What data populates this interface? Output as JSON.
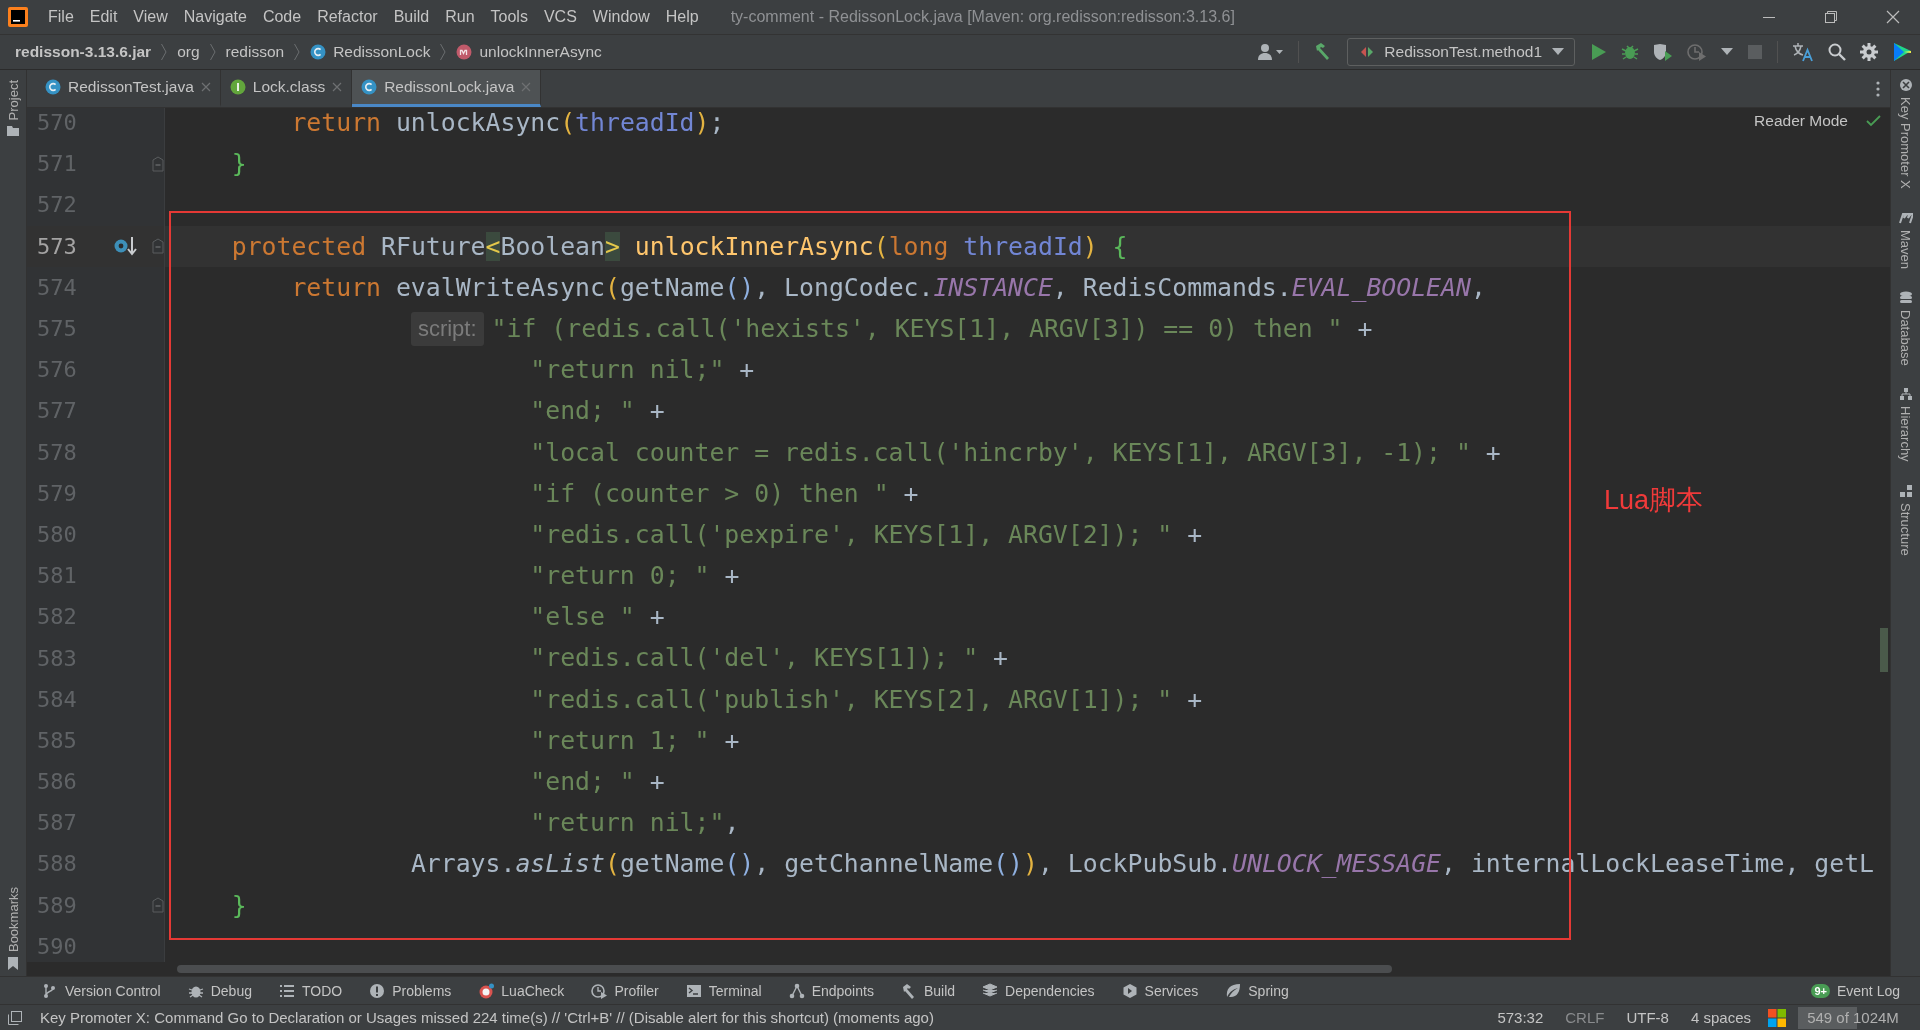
{
  "menu_bar": {
    "items": [
      {
        "label": "File"
      },
      {
        "label": "Edit"
      },
      {
        "label": "View"
      },
      {
        "label": "Navigate"
      },
      {
        "label": "Code"
      },
      {
        "label": "Refactor"
      },
      {
        "label": "Build"
      },
      {
        "label": "Run"
      },
      {
        "label": "Tools"
      },
      {
        "label": "VCS"
      },
      {
        "label": "Window"
      },
      {
        "label": "Help"
      }
    ],
    "title": "ty-comment - RedissonLock.java [Maven: org.redisson:redisson:3.13.6]"
  },
  "breadcrumbs": [
    {
      "label": "redisson-3.13.6.jar",
      "kind": "jar"
    },
    {
      "label": "org",
      "kind": "package"
    },
    {
      "label": "redisson",
      "kind": "package"
    },
    {
      "label": "RedissonLock",
      "kind": "class"
    },
    {
      "label": "unlockInnerAsync",
      "kind": "method"
    }
  ],
  "run_configuration": "RedissonTest.method1",
  "tabs": [
    {
      "label": "RedissonTest.java",
      "kind": "class",
      "selected": false
    },
    {
      "label": "Lock.class",
      "kind": "interface",
      "selected": false
    },
    {
      "label": "RedissonLock.java",
      "kind": "class",
      "selected": true
    }
  ],
  "left_tool_strip": [
    "Project",
    "Bookmarks"
  ],
  "right_tool_strip": [
    {
      "label": "Key Promoter X",
      "kind": "keypromoter"
    },
    {
      "label": "Maven",
      "kind": "maven"
    },
    {
      "label": "Database",
      "kind": "database"
    },
    {
      "label": "Hierarchy",
      "kind": "hierarchy"
    },
    {
      "label": "Structure",
      "kind": "structure"
    }
  ],
  "editor": {
    "reader_mode": "Reader Mode",
    "annotation": "Lua脚本",
    "lines": [
      {
        "number": "570",
        "current": false,
        "fold": false,
        "tokens": [
          {
            "kind": "keyword",
            "text": "        return"
          },
          {
            "kind": "plain",
            "text": " unlockAsync"
          },
          {
            "kind": "paren",
            "text": "("
          },
          {
            "kind": "param",
            "text": "threadId"
          },
          {
            "kind": "paren",
            "text": ")"
          },
          {
            "kind": "plain",
            "text": ";"
          }
        ]
      },
      {
        "number": "571",
        "current": false,
        "fold": true,
        "tokens": [
          {
            "kind": "brace",
            "text": "    }"
          }
        ]
      },
      {
        "number": "572",
        "current": false,
        "fold": false
      },
      {
        "number": "573",
        "current": true,
        "fold": true,
        "override_marker": true,
        "tokens": [
          {
            "kind": "keyword",
            "text": "    protected"
          },
          {
            "kind": "plain",
            "text": " RFuture"
          },
          {
            "kind": "angle",
            "text": "<"
          },
          {
            "kind": "plain",
            "text": "Boolean"
          },
          {
            "kind": "angle",
            "text": ">"
          },
          {
            "kind": "declaration",
            "text": " unlockInnerAsync"
          },
          {
            "kind": "paren",
            "text": "("
          },
          {
            "kind": "keyword",
            "text": "long"
          },
          {
            "kind": "param",
            "text": " threadId"
          },
          {
            "kind": "paren",
            "text": ")"
          },
          {
            "kind": "brace",
            "text": " {"
          }
        ]
      },
      {
        "number": "574",
        "current": false,
        "fold": false,
        "tokens": [
          {
            "kind": "keyword",
            "text": "        return"
          },
          {
            "kind": "plain",
            "text": " evalWriteAsync"
          },
          {
            "kind": "paren",
            "text": "("
          },
          {
            "kind": "plain",
            "text": "getName"
          },
          {
            "kind": "paren2",
            "text": "()"
          },
          {
            "kind": "plain",
            "text": ", LongCodec."
          },
          {
            "kind": "field",
            "text": "INSTANCE"
          },
          {
            "kind": "plain",
            "text": ", RedisCommands."
          },
          {
            "kind": "field",
            "text": "EVAL_BOOLEAN"
          },
          {
            "kind": "plain",
            "text": ","
          }
        ]
      },
      {
        "number": "575",
        "current": false,
        "fold": false,
        "tokens": [
          {
            "kind": "hint",
            "text": "                script:"
          },
          {
            "kind": "string",
            "text": "\"if (redis.call('hexists', KEYS[1], ARGV[3]) == 0) then \""
          },
          {
            "kind": "plain",
            "text": " +"
          }
        ]
      },
      {
        "number": "576",
        "current": false,
        "fold": false,
        "tokens": [
          {
            "kind": "string",
            "text": "                        \"return nil;\""
          },
          {
            "kind": "plain",
            "text": " +"
          }
        ]
      },
      {
        "number": "577",
        "current": false,
        "fold": false,
        "tokens": [
          {
            "kind": "string",
            "text": "                        \"end; \""
          },
          {
            "kind": "plain",
            "text": " +"
          }
        ]
      },
      {
        "number": "578",
        "current": false,
        "fold": false,
        "tokens": [
          {
            "kind": "string",
            "text": "                        \"local counter = redis.call('hincrby', KEYS[1], ARGV[3], -1); \""
          },
          {
            "kind": "plain",
            "text": " +"
          }
        ]
      },
      {
        "number": "579",
        "current": false,
        "fold": false,
        "tokens": [
          {
            "kind": "string",
            "text": "                        \"if (counter > 0) then \""
          },
          {
            "kind": "plain",
            "text": " +"
          }
        ]
      },
      {
        "number": "580",
        "current": false,
        "fold": false,
        "tokens": [
          {
            "kind": "string",
            "text": "                        \"redis.call('pexpire', KEYS[1], ARGV[2]); \""
          },
          {
            "kind": "plain",
            "text": " +"
          }
        ]
      },
      {
        "number": "581",
        "current": false,
        "fold": false,
        "tokens": [
          {
            "kind": "string",
            "text": "                        \"return 0; \""
          },
          {
            "kind": "plain",
            "text": " +"
          }
        ]
      },
      {
        "number": "582",
        "current": false,
        "fold": false,
        "tokens": [
          {
            "kind": "string",
            "text": "                        \"else \""
          },
          {
            "kind": "plain",
            "text": " +"
          }
        ]
      },
      {
        "number": "583",
        "current": false,
        "fold": false,
        "tokens": [
          {
            "kind": "string",
            "text": "                        \"redis.call('del', KEYS[1]); \""
          },
          {
            "kind": "plain",
            "text": " +"
          }
        ]
      },
      {
        "number": "584",
        "current": false,
        "fold": false,
        "tokens": [
          {
            "kind": "string",
            "text": "                        \"redis.call('publish', KEYS[2], ARGV[1]); \""
          },
          {
            "kind": "plain",
            "text": " +"
          }
        ]
      },
      {
        "number": "585",
        "current": false,
        "fold": false,
        "tokens": [
          {
            "kind": "string",
            "text": "                        \"return 1; \""
          },
          {
            "kind": "plain",
            "text": " +"
          }
        ]
      },
      {
        "number": "586",
        "current": false,
        "fold": false,
        "tokens": [
          {
            "kind": "string",
            "text": "                        \"end; \""
          },
          {
            "kind": "plain",
            "text": " +"
          }
        ]
      },
      {
        "number": "587",
        "current": false,
        "fold": false,
        "tokens": [
          {
            "kind": "string",
            "text": "                        \"return nil;\""
          },
          {
            "kind": "plain",
            "text": ","
          }
        ]
      },
      {
        "number": "588",
        "current": false,
        "fold": false,
        "tokens": [
          {
            "kind": "plain",
            "text": "                Arrays."
          },
          {
            "kind": "italic",
            "text": "asList"
          },
          {
            "kind": "paren",
            "text": "("
          },
          {
            "kind": "plain",
            "text": "getName"
          },
          {
            "kind": "paren2",
            "text": "()"
          },
          {
            "kind": "plain",
            "text": ", getChannelName"
          },
          {
            "kind": "paren2",
            "text": "()"
          },
          {
            "kind": "paren",
            "text": ")"
          },
          {
            "kind": "plain",
            "text": ", LockPubSub."
          },
          {
            "kind": "field",
            "text": "UNLOCK_MESSAGE"
          },
          {
            "kind": "plain",
            "text": ", internalLockLeaseTime, getL"
          }
        ]
      },
      {
        "number": "589",
        "current": false,
        "fold": true,
        "tokens": [
          {
            "kind": "brace",
            "text": "    }"
          }
        ]
      },
      {
        "number": "590",
        "current": false,
        "fold": false
      }
    ]
  },
  "tool_windows": [
    {
      "label": "Version Control",
      "kind": "vcs"
    },
    {
      "label": "Debug",
      "kind": "debug"
    },
    {
      "label": "TODO",
      "kind": "todo"
    },
    {
      "label": "Problems",
      "kind": "problems"
    },
    {
      "label": "LuaCheck",
      "kind": "luacheck"
    },
    {
      "label": "Profiler",
      "kind": "profiler"
    },
    {
      "label": "Terminal",
      "kind": "terminal"
    },
    {
      "label": "Endpoints",
      "kind": "endpoints"
    },
    {
      "label": "Build",
      "kind": "build"
    },
    {
      "label": "Dependencies",
      "kind": "dependencies"
    },
    {
      "label": "Services",
      "kind": "services"
    },
    {
      "label": "Spring",
      "kind": "spring"
    }
  ],
  "event_log": {
    "label": "Event Log",
    "badge": "9+"
  },
  "status_bar": {
    "message": "Key Promoter X: Command Go to Declaration or Usages missed 224 time(s) // 'Ctrl+B' // (Disable alert for this shortcut) (moments ago)",
    "position": "573:32",
    "line_separator": "CRLF",
    "encoding": "UTF-8",
    "indent": "4 spaces",
    "memory": {
      "text": "549 of 1024M",
      "level": 0.536
    }
  }
}
